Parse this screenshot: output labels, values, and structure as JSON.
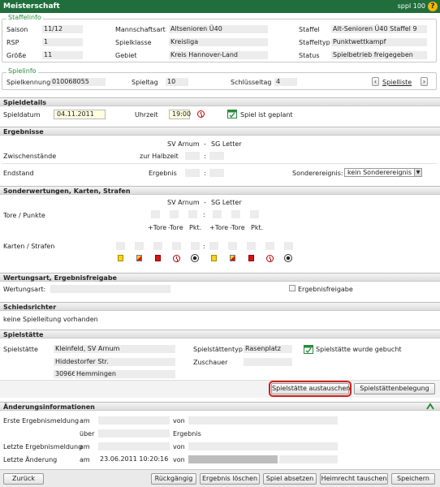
{
  "header": {
    "title": "Meisterschaft",
    "user": "sppl 100",
    "help_label": "?"
  },
  "staffelinfo": {
    "legend": "Staffelinfo",
    "saison_label": "Saison",
    "saison": "11/12",
    "rsp_label": "RSP",
    "rsp": "1",
    "groesse_label": "Größe",
    "groesse": "11",
    "mannschaftsart_label": "Mannschaftsart",
    "mannschaftsart": "Altsenioren Ü40",
    "spielklasse_label": "Spielklasse",
    "spielklasse": "Kreisliga",
    "gebiet_label": "Gebiet",
    "gebiet": "Kreis Hannover-Land",
    "staffel_label": "Staffel",
    "staffel": "Alt-Senioren Ü40 Staffel 9",
    "staffeltyp_label": "Staffeltyp",
    "staffeltyp": "Punktwettkampf",
    "status_label": "Status",
    "status": "Spielbetrieb freigegeben"
  },
  "spielinfo": {
    "legend": "Spielinfo",
    "kennung_label": "Spielkennung",
    "kennung": "010068055",
    "spieltag_label": "Spieltag",
    "spieltag": "10",
    "schluessel_label": "Schlüsseltag",
    "schluessel": "4",
    "prev_label": "‹",
    "spielliste_label": "Spielliste",
    "next_label": "›"
  },
  "spieldetails": {
    "title": "Spieldetails",
    "datum_label": "Spieldatum",
    "datum": "04.11.2011",
    "uhrzeit_label": "Uhrzeit",
    "uhrzeit": "19:00",
    "status": "Spiel ist geplant"
  },
  "ergebnisse": {
    "title": "Ergebnisse",
    "home": "SV Arnum",
    "dash": "-",
    "away": "SG Letter",
    "zwischen_label": "Zwischenstände",
    "halbzeit_label": "zur Halbzeit",
    "endstand_label": "Endstand",
    "ergebnis_label": "Ergebnis",
    "sonder_label": "Sonderereignis:",
    "sonder_value": "kein Sonderereignis",
    "colon": ":"
  },
  "sonderwertungen": {
    "title": "Sonderwertungen, Karten, Strafen",
    "tore_label": "Tore / Punkte",
    "karten_label": "Karten / Strafen",
    "col_tore_plus": "+Tore",
    "col_tore_minus": "-Tore",
    "col_pkt": "Pkt."
  },
  "wertung": {
    "title": "Wertungsart, Ergebnisfreigabe",
    "art_label": "Wertungsart:",
    "freigabe_label": "Ergebnisfreigabe"
  },
  "schiedsrichter": {
    "title": "Schiedsrichter",
    "text": "keine Spielleitung vorhanden"
  },
  "spielstaette": {
    "title": "Spielstätte",
    "label": "Spielstätte",
    "name": "Kleinfeld, SV Arnum",
    "strasse": "Hiddestorfer Str.",
    "plz": "30966",
    "ort": "Hemmingen",
    "typ_label": "Spielstättentyp",
    "typ": "Rasenplatz",
    "zuschauer_label": "Zuschauer",
    "gebucht": "Spielstätte wurde gebucht",
    "austauschen_label": "Spielstätte austauschen",
    "belegung_label": "Spielstättenbelegung"
  },
  "aenderung": {
    "title": "Änderungsinformationen",
    "erste_label": "Erste Ergebnismeldung",
    "am": "am",
    "von": "von",
    "ueber": "über",
    "ergebnis": "Ergebnis",
    "letzte_erg_label": "Letzte Ergebnismeldung",
    "letzte_aend_label": "Letzte Änderung",
    "letzte_aend_value": "23.06.2011 10:20:16"
  },
  "footer": {
    "zurueck": "Zurück",
    "rueckgaengig": "Rückgängig",
    "loeschen": "Ergebnis löschen",
    "absetzen": "Spiel absetzen",
    "heimrecht": "Heimrecht tauschen",
    "speichern": "Speichern"
  },
  "colors": {
    "header_green": "#1f6e3c",
    "legend_green": "#2a8a3a",
    "highlight_red": "#d61d1d"
  }
}
